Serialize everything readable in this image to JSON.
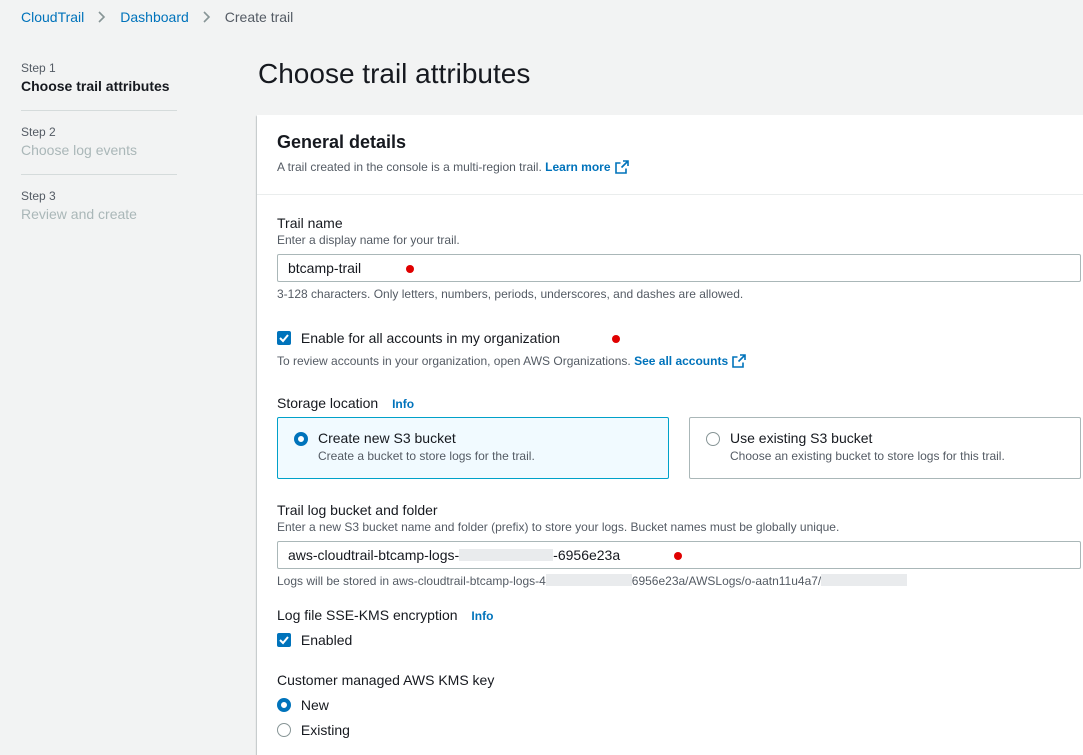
{
  "breadcrumb": {
    "items": [
      "CloudTrail",
      "Dashboard"
    ],
    "current": "Create trail"
  },
  "steps": [
    {
      "num": "Step 1",
      "title": "Choose trail attributes",
      "active": true
    },
    {
      "num": "Step 2",
      "title": "Choose log events",
      "active": false
    },
    {
      "num": "Step 3",
      "title": "Review and create",
      "active": false
    }
  ],
  "page_title": "Choose trail attributes",
  "general": {
    "title": "General details",
    "desc": "A trail created in the console is a multi-region trail.",
    "learn_more": "Learn more"
  },
  "trail_name": {
    "label": "Trail name",
    "sub": "Enter a display name for your trail.",
    "value": "btcamp-trail",
    "hint": "3-128 characters. Only letters, numbers, periods, underscores, and dashes are allowed."
  },
  "org": {
    "label": "Enable for all accounts in my organization",
    "checked": true,
    "hint": "To review accounts in your organization, open AWS Organizations.",
    "link": "See all accounts"
  },
  "storage": {
    "label": "Storage location",
    "info": "Info",
    "options": [
      {
        "title": "Create new S3 bucket",
        "desc": "Create a bucket to store logs for the trail.",
        "selected": true
      },
      {
        "title": "Use existing S3 bucket",
        "desc": "Choose an existing bucket to store logs for this trail.",
        "selected": false
      }
    ]
  },
  "bucket": {
    "label": "Trail log bucket and folder",
    "sub": "Enter a new S3 bucket name and folder (prefix) to store your logs. Bucket names must be globally unique.",
    "value_prefix": "aws-cloudtrail-btcamp-logs-",
    "value_suffix": "-6956e23a",
    "hint_prefix": "Logs will be stored in aws-cloudtrail-btcamp-logs-4",
    "hint_middle": "6956e23a/AWSLogs/o-aatn11u4a7/"
  },
  "sse": {
    "label": "Log file SSE-KMS encryption",
    "info": "Info",
    "checkbox_label": "Enabled",
    "checked": true
  },
  "kms": {
    "label": "Customer managed AWS KMS key",
    "options": [
      {
        "label": "New",
        "selected": true
      },
      {
        "label": "Existing",
        "selected": false
      }
    ]
  },
  "colors": {
    "accent": "#0073bb",
    "marker": "#e00000"
  }
}
